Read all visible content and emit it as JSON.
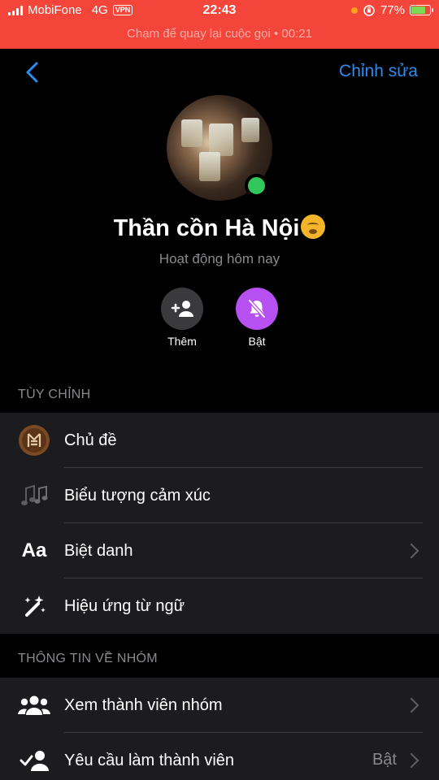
{
  "status_bar": {
    "carrier": "MobiFone",
    "network": "4G",
    "vpn": "VPN",
    "time": "22:43",
    "battery": "77%",
    "battery_level": 0.77,
    "call_banner": "Chạm để quay lại cuộc gọi • 00:21"
  },
  "nav": {
    "edit_label": "Chỉnh sửa"
  },
  "profile": {
    "name": "Thần cồn Hà Nội",
    "status": "Hoạt động hôm nay",
    "online": true
  },
  "actions": [
    {
      "label": "Thêm",
      "icon": "add-person-icon"
    },
    {
      "label": "Bật",
      "icon": "bell-off-icon"
    }
  ],
  "sections": {
    "customize": {
      "header": "TÙY CHỈNH",
      "items": [
        {
          "label": "Chủ đề",
          "icon": "theme-icon"
        },
        {
          "label": "Biểu tượng cảm xúc",
          "icon": "music-notes-icon"
        },
        {
          "label": "Biệt danh",
          "icon": "text-aa-icon"
        },
        {
          "label": "Hiệu ứng từ ngữ",
          "icon": "magic-wand-icon"
        }
      ]
    },
    "group_info": {
      "header": "THÔNG TIN VỀ NHÓM",
      "items": [
        {
          "label": "Xem thành viên nhóm",
          "icon": "group-members-icon"
        },
        {
          "label": "Yêu cầu làm thành viên",
          "icon": "member-request-icon",
          "value": "Bật"
        }
      ]
    }
  },
  "colors": {
    "status_bar_bg": "#f4453b",
    "accent_blue": "#2d8cf0",
    "mute_purple": "#b750f0",
    "online_green": "#31c75a"
  }
}
